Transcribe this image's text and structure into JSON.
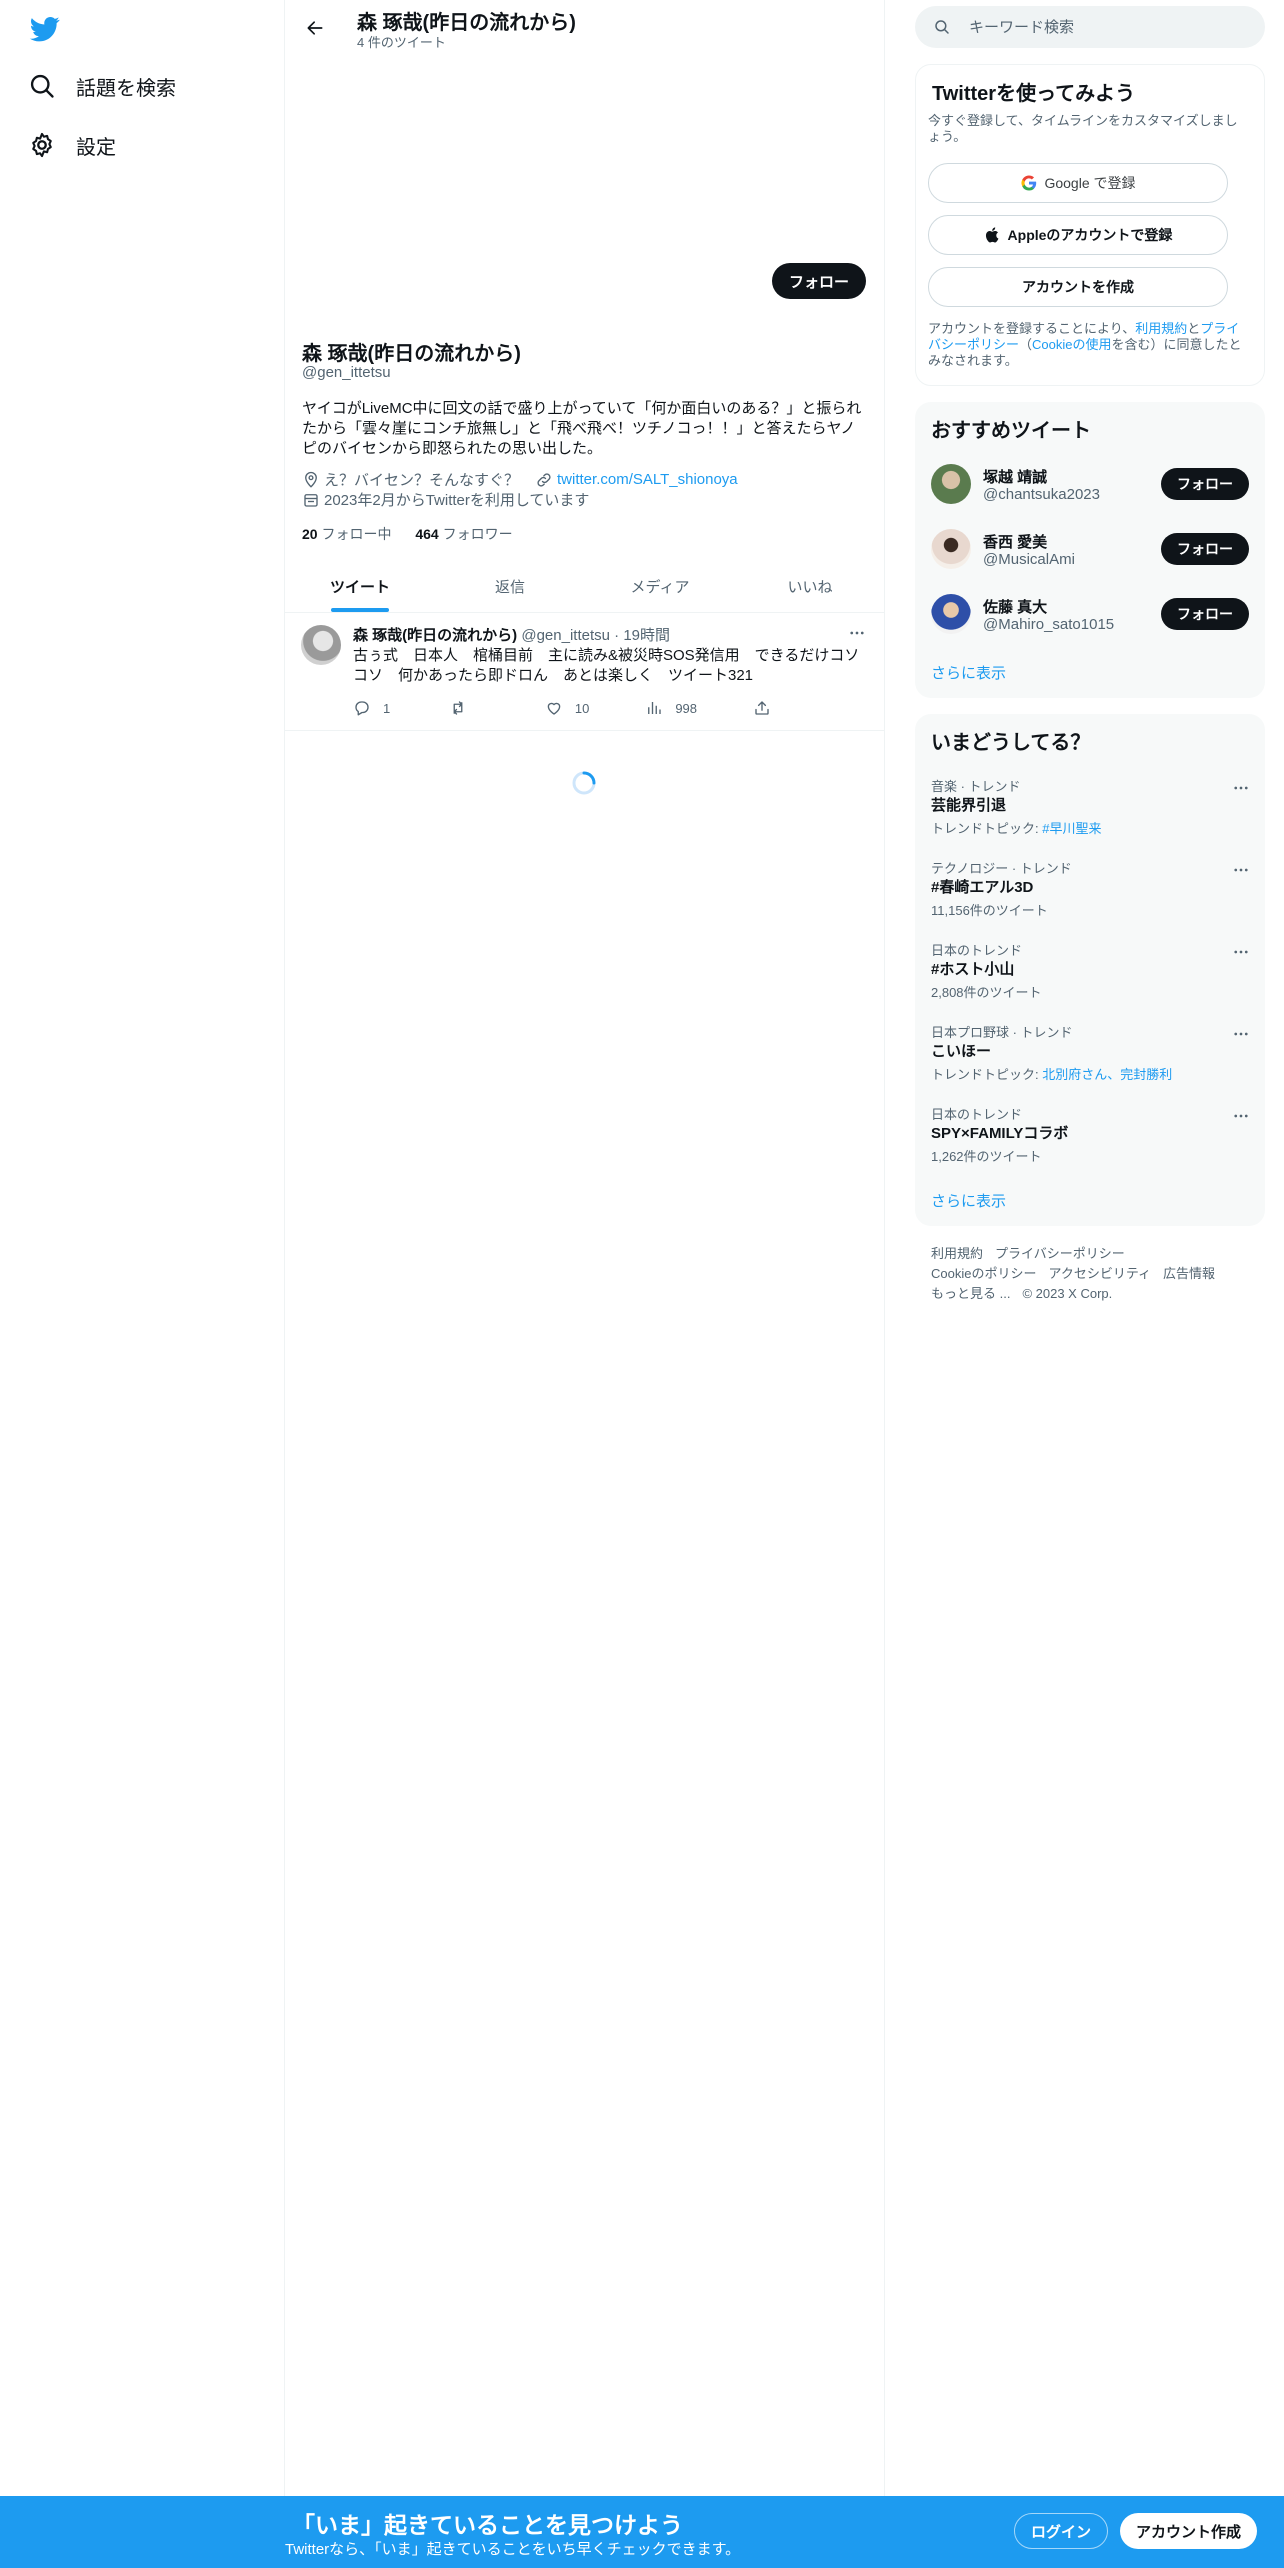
{
  "nav": {
    "items": [
      {
        "label": "話題を検索",
        "icon": "search-icon"
      },
      {
        "label": "設定",
        "icon": "gear-icon"
      }
    ]
  },
  "header": {
    "name": "森 琢哉(昨日の流れから)",
    "tweet_count": "4 件のツイート"
  },
  "profile": {
    "follow_label": "フォロー",
    "name": "森 琢哉(昨日の流れから)",
    "handle": "@gen_ittetsu",
    "bio": "ヤイコがLiveMC中に回文の話で盛り上がっていて「何か面白いのある？」と振られたから「雲々崖にコンチ旅無し」と「飛べ飛べ！ツチノコっ！！」と答えたらヤノピのバイセンから即怒られたの思い出した。",
    "location": "え？バイセン？そんなすぐ？",
    "url": "twitter.com/SALT_shionoya",
    "joined": "2023年2月からTwitterを利用しています",
    "following_count": "20",
    "following_label": "フォロー中",
    "followers_count": "464",
    "followers_label": "フォロワー"
  },
  "tabs": [
    "ツイート",
    "返信",
    "メディア",
    "いいね"
  ],
  "tweet": {
    "name": "森 琢哉(昨日の流れから)",
    "handle": "@gen_ittetsu",
    "sep": "·",
    "time": "19時間",
    "text": "古ぅ式　日本人　棺桶目前　主に読み&被災時SOS発信用　できるだけコソコソ　何かあったら即ドロん　あとは楽しく　ツイート321",
    "replies": "1",
    "retweets": "",
    "likes": "10",
    "views": "998"
  },
  "search": {
    "placeholder": "キーワード検索"
  },
  "signup": {
    "title": "Twitterを使ってみよう",
    "subtitle": "今すぐ登録して、タイムラインをカスタマイズしましょう。",
    "google": "Google で登録",
    "apple": "Appleのアカウントで登録",
    "create": "アカウントを作成",
    "terms_pre": "アカウントを登録することにより、",
    "terms_link": "利用規約",
    "terms_and": "と",
    "privacy_link": "プライバシーポリシー",
    "paren_open": "（",
    "cookie_link": "Cookieの使用",
    "terms_post": "を含む）に同意したとみなされます。"
  },
  "recommended": {
    "title": "おすすめツイート",
    "follow_label": "フォロー",
    "users": [
      {
        "name": "塚越 靖誠",
        "handle": "@chantsuka2023",
        "avatar_color": "#5a7b4e"
      },
      {
        "name": "香西 愛美",
        "handle": "@MusicalAmi",
        "avatar_color": "#e8d8cf"
      },
      {
        "name": "佐藤 真大",
        "handle": "@Mahiro_sato1015",
        "avatar_color": "#2e4fa8"
      }
    ],
    "more": "さらに表示"
  },
  "trends": {
    "title": "いまどうしてる？",
    "items": [
      {
        "context": "音楽 · トレンド",
        "name": "芸能界引退",
        "sub_pre": "トレンドトピック: ",
        "sub_link": "#早川聖来"
      },
      {
        "context": "テクノロジー · トレンド",
        "name": "#春崎エアル3D",
        "sub_pre": "11,156件のツイート",
        "sub_link": ""
      },
      {
        "context": "日本のトレンド",
        "name": "#ホスト小山",
        "sub_pre": "2,808件のツイート",
        "sub_link": ""
      },
      {
        "context": "日本プロ野球 · トレンド",
        "name": "こいほー",
        "sub_pre": "トレンドトピック: ",
        "sub_link": "北別府さん、完封勝利"
      },
      {
        "context": "日本のトレンド",
        "name": "SPY×FAMILYコラボ",
        "sub_pre": "1,262件のツイート",
        "sub_link": ""
      }
    ],
    "more": "さらに表示"
  },
  "footer": {
    "links": [
      "利用規約",
      "プライバシーポリシー",
      "Cookieのポリシー",
      "アクセシビリティ",
      "広告情報",
      "もっと見る ..."
    ],
    "copyright": "© 2023 X Corp."
  },
  "bottom": {
    "title": "「いま」起きていることを見つけよう",
    "subtitle": "Twitterなら、「いま」起きていることをいち早くチェックできます。",
    "login": "ログイン",
    "signup": "アカウント作成"
  },
  "colors": {
    "brand": "#1d9bf0",
    "text": "#0f1419",
    "muted": "#536471"
  }
}
